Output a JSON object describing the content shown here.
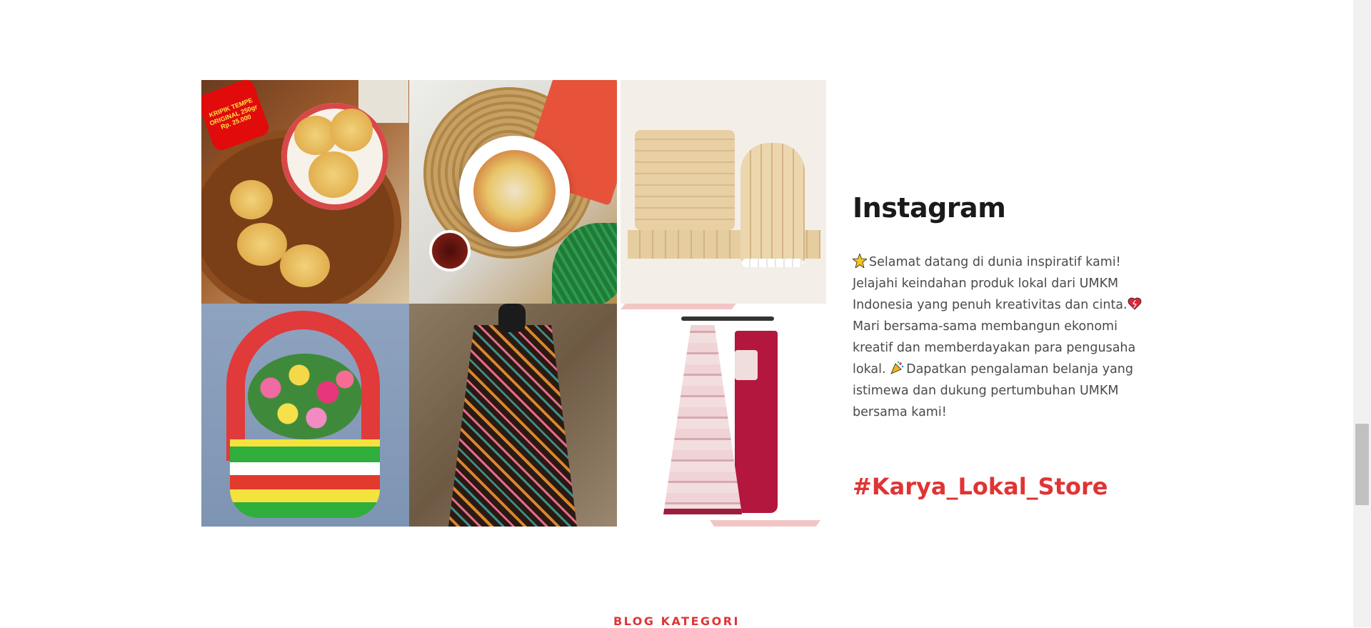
{
  "instagram": {
    "title": "Instagram",
    "description": {
      "line1": "Selamat datang di dunia inspiratif kami! Jelajahi keindahan produk lokal dari UMKM Indonesia yang penuh kreativitas dan cinta.",
      "line2": " Mari bersama-sama membangun ekonomi kreatif dan memberdayakan para pengusaha lokal. ",
      "line3": "Dapatkan pengalaman belanja yang istimewa dan dukung pertumbuhan UMKM bersama kami!",
      "icons": [
        "sparkle-icon",
        "heart-icon",
        "party-popper-icon"
      ]
    },
    "hashtag": "#Karya_Lokal_Store"
  },
  "gallery": {
    "items": [
      {
        "name": "kripik-tempe",
        "badge_text": "KRIPIK TEMPE ORIGINAL 250gr Rp. 25.000"
      },
      {
        "name": "baso-aci"
      },
      {
        "name": "popsicle-stick-craft"
      },
      {
        "name": "bottle-cap-basket"
      },
      {
        "name": "batik-coat"
      },
      {
        "name": "mukena-set"
      }
    ]
  },
  "blog": {
    "section_label": "BLOG KATEGORI"
  },
  "colors": {
    "accent": "#e03434",
    "heading": "#1a1a1a",
    "body_text": "#4a4a4a",
    "pink_accent_bar": "#f2c6c6"
  }
}
